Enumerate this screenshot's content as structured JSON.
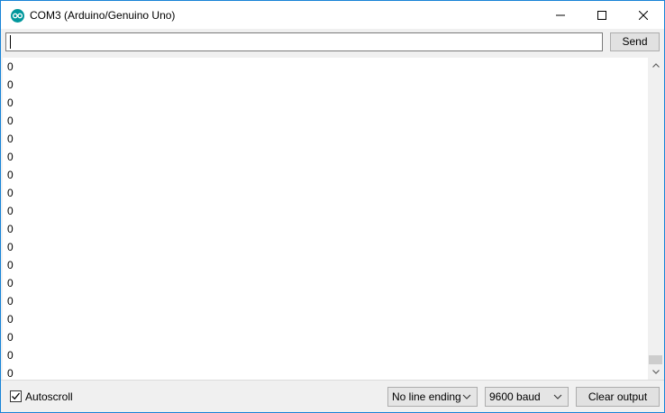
{
  "window": {
    "title": "COM3 (Arduino/Genuino Uno)"
  },
  "send": {
    "input_value": "",
    "button_label": "Send"
  },
  "output": {
    "lines": [
      "0",
      "0",
      "0",
      "0",
      "0",
      "0",
      "0",
      "0",
      "0",
      "0",
      "0",
      "0",
      "0",
      "0",
      "0",
      "0",
      "0",
      "0"
    ]
  },
  "footer": {
    "autoscroll_label": "Autoscroll",
    "autoscroll_checked": true,
    "line_ending": "No line ending",
    "baud": "9600 baud",
    "clear_label": "Clear output"
  },
  "colors": {
    "icon": "#00979c",
    "window_border": "#1883d7"
  },
  "icons": [
    "arduino-logo-icon",
    "minimize-icon",
    "maximize-icon",
    "close-icon",
    "scroll-up-icon",
    "scroll-down-icon",
    "chevron-down-icon",
    "checkmark-icon"
  ]
}
